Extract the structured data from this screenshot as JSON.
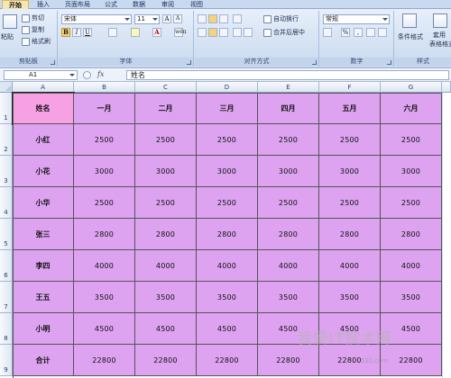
{
  "ribbon": {
    "tabs": [
      "开始",
      "插入",
      "页面布局",
      "公式",
      "数据",
      "审阅",
      "视图"
    ],
    "active_tab": "开始",
    "clipboard": {
      "paste": "粘贴",
      "cut": "剪切",
      "copy": "复制",
      "format_painter": "格式刷",
      "title": "剪贴板"
    },
    "font": {
      "name": "宋体",
      "size": "11",
      "grow": "A",
      "shrink": "A",
      "bold": "B",
      "italic": "I",
      "underline": "U",
      "font_color_letter": "A",
      "wen": "wén",
      "title": "字体"
    },
    "alignment": {
      "wrap_text": "自动换行",
      "merge_center": "合并后居中",
      "title": "对齐方式"
    },
    "number": {
      "format": "常规",
      "percent": "%",
      "comma": ",",
      "title": "数字"
    },
    "styles": {
      "conditional": "条件格式",
      "format_as_table": "套用",
      "table_format": "表格格式",
      "title": "样式"
    }
  },
  "formula_bar": {
    "name_box": "A1",
    "fx": "fx",
    "content": "姓名"
  },
  "grid": {
    "columns": [
      "A",
      "B",
      "C",
      "D",
      "E",
      "F",
      "G"
    ],
    "row_numbers": [
      "1",
      "2",
      "3",
      "4",
      "5",
      "6",
      "7",
      "8",
      "9"
    ],
    "header": [
      "姓名",
      "一月",
      "二月",
      "三月",
      "四月",
      "五月",
      "六月"
    ],
    "rows": [
      {
        "name": "小红",
        "values": [
          "2500",
          "2500",
          "2500",
          "2500",
          "2500",
          "2500"
        ]
      },
      {
        "name": "小花",
        "values": [
          "3000",
          "3000",
          "3000",
          "3000",
          "3000",
          "3000"
        ]
      },
      {
        "name": "小华",
        "values": [
          "2500",
          "2500",
          "2500",
          "2500",
          "2500",
          "2500"
        ]
      },
      {
        "name": "张三",
        "values": [
          "2800",
          "2800",
          "2800",
          "2800",
          "2800",
          "2800"
        ]
      },
      {
        "name": "李四",
        "values": [
          "4000",
          "4000",
          "4000",
          "4000",
          "4000",
          "4000"
        ]
      },
      {
        "name": "王五",
        "values": [
          "3500",
          "3500",
          "3500",
          "3500",
          "3500",
          "3500"
        ]
      },
      {
        "name": "小明",
        "values": [
          "4500",
          "4500",
          "4500",
          "4500",
          "4500",
          "4500"
        ]
      },
      {
        "name": "合计",
        "values": [
          "22800",
          "22800",
          "22800",
          "22800",
          "22800",
          "22800"
        ]
      }
    ]
  },
  "watermark": {
    "text": "我爱IT技术网",
    "url": "52ij.com"
  },
  "colors": {
    "cell_fill": "#dda3f0",
    "selected_fill": "#f7a0e4",
    "ribbon_bg": "#d5e2f3"
  }
}
